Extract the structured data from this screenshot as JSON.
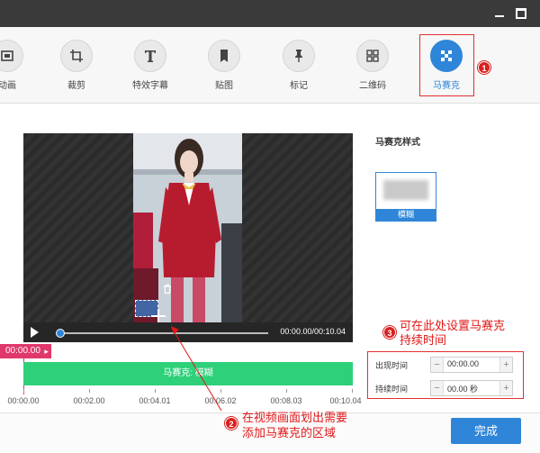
{
  "toolbar": {
    "items": [
      {
        "label": "动画",
        "icon": "animation-icon"
      },
      {
        "label": "裁剪",
        "icon": "crop-icon"
      },
      {
        "label": "特效字幕",
        "icon": "text-icon"
      },
      {
        "label": "贴图",
        "icon": "bookmark-icon"
      },
      {
        "label": "标记",
        "icon": "pin-icon"
      },
      {
        "label": "二维码",
        "icon": "qr-code-icon"
      },
      {
        "label": "马赛克",
        "icon": "mosaic-icon",
        "active": true
      }
    ]
  },
  "player": {
    "time": "00:00.00/00:10.04",
    "progress": 0
  },
  "timeline": {
    "current_time": "00:00.00",
    "mosaic_track_label": "马赛克: 模糊",
    "ruler": [
      "00:00.00",
      "00:02.00",
      "00:04.01",
      "00:06.02",
      "00:08.03",
      "00:10.04"
    ]
  },
  "side": {
    "title": "马赛克样式",
    "style_option": "模糊"
  },
  "settings": {
    "appear_label": "出现时间",
    "appear_value": "00:00.00",
    "duration_label": "持续时间",
    "duration_value": "00.00 秒"
  },
  "annotations": {
    "a1": "1",
    "a2": "2",
    "a3": "3",
    "text2_line1": "在视频画面划出需要",
    "text2_line2": "添加马赛克的区域",
    "text3_line1": "可在此处设置马赛克",
    "text3_line2": "持续时间"
  },
  "footer": {
    "finish_label": "完成"
  },
  "colors": {
    "accent": "#2f86d8",
    "track": "#2fd07a",
    "playhead": "#e0386a",
    "annotation": "#e01818"
  }
}
